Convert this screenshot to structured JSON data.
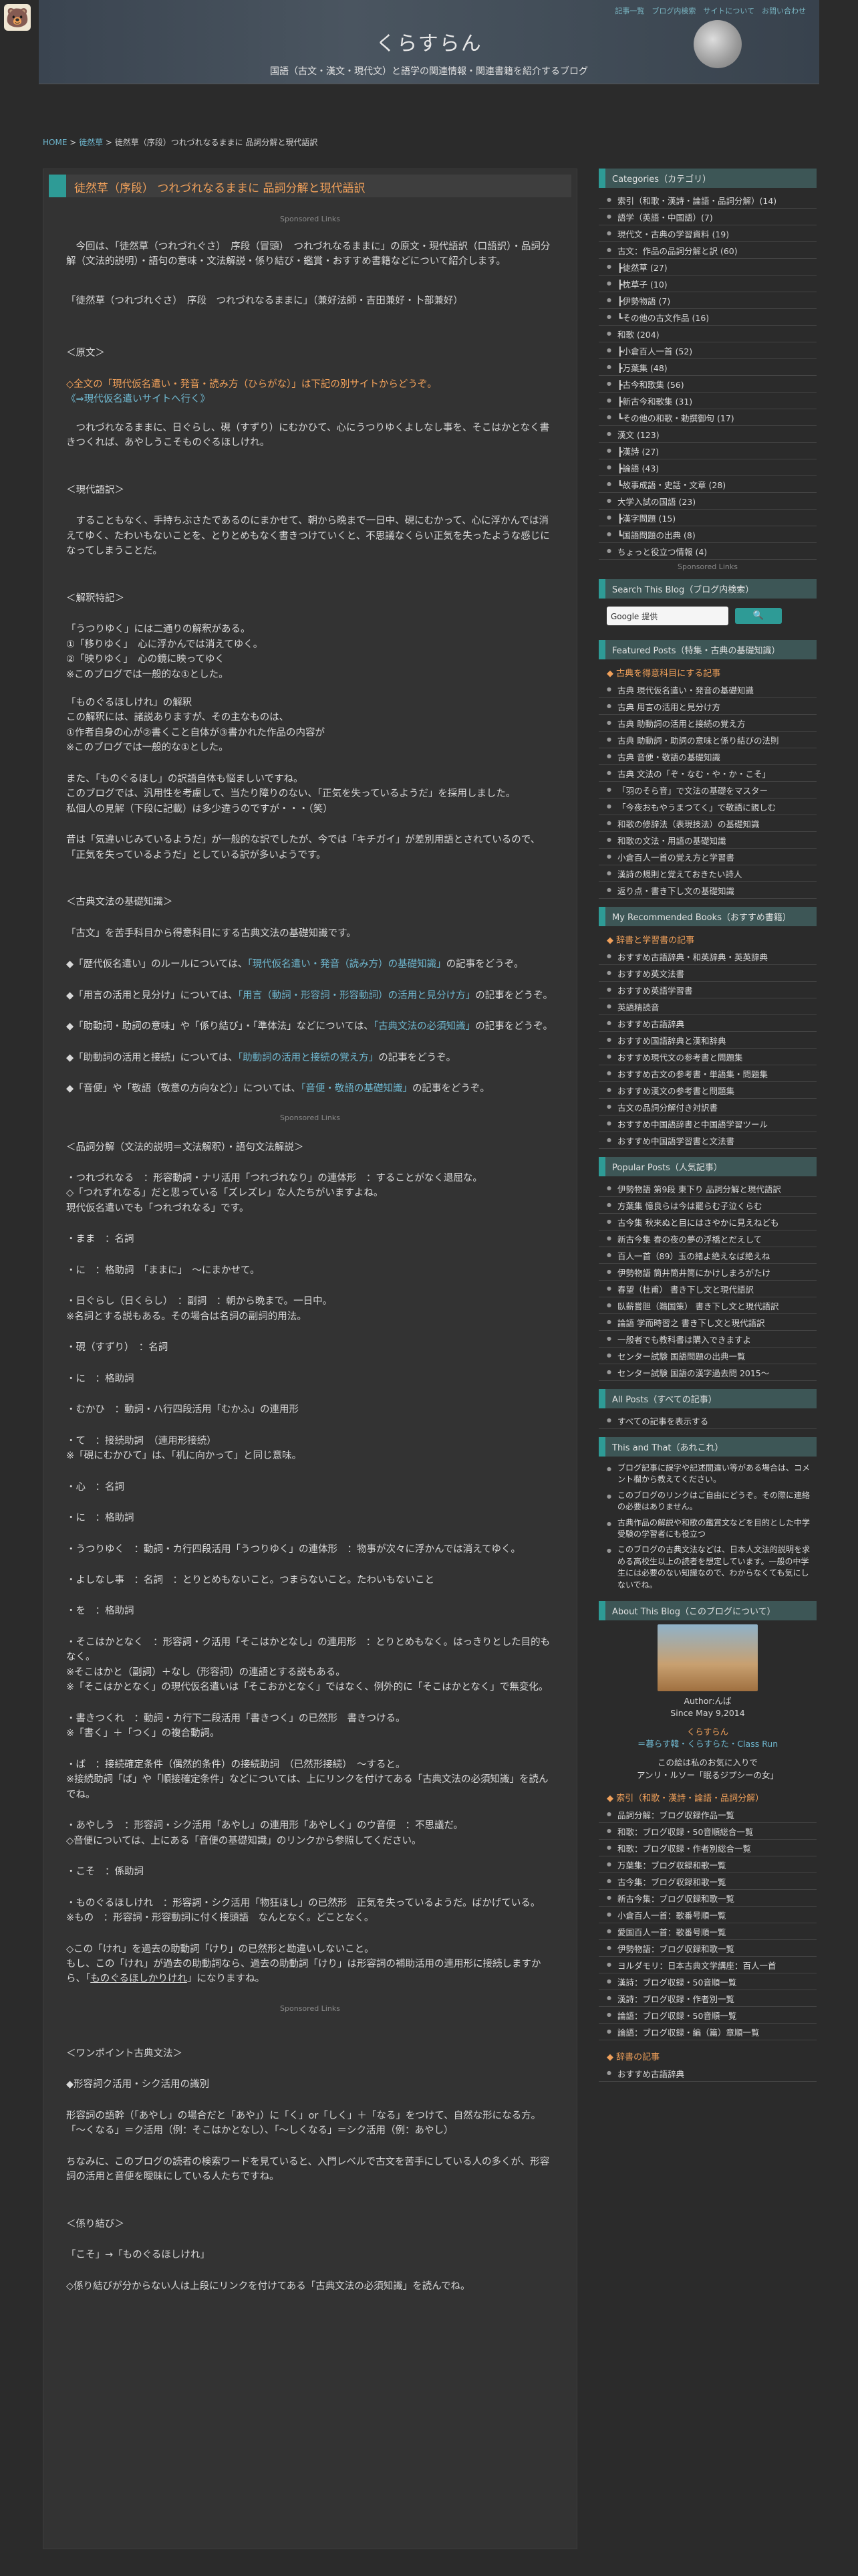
{
  "mascot": "🐻",
  "header": {
    "title": "くらすらん",
    "subtitle": "国語（古文・漢文・現代文）と語学の関連情報・関連書籍を紹介するブログ",
    "topnav": "記事一覧　ブログ内検索　サイトについて　お問い合わせ"
  },
  "breadcrumb": {
    "home": "HOME",
    "sep1": " > ",
    "cat": "徒然草",
    "rest": " > 徒然草（序段）つれづれなるままに 品詞分解と現代語訳"
  },
  "post": {
    "title": "徒然草（序段） つれづれなるままに 品詞分解と現代語訳",
    "ad": "Sponsored Links",
    "intro": "　今回は、「徒然草（つれづれぐさ）　序段（冒頭）　つれづれなるままに」の原文・現代語訳（口語訳）・品詞分解（文法的説明）・語句の意味・文法解説・係り結び・鑑賞・おすすめ書籍などについて紹介します。",
    "heading": "「徒然草（つれづれぐさ）　序段　つれづれなるままに」（兼好法師・吉田兼好・卜部兼好）",
    "gen_h": "＜原文＞",
    "gen_note": "◇全文の「現代仮名遣い・発音・読み方（ひらがな）」は下記の別サイトからどうぞ。",
    "gen_link": "《⇒現代仮名遣いサイトへ行く》",
    "gen_text": "　つれづれなるままに、日ぐらし、硯（すずり）にむかひて、心にうつりゆくよしなし事を、そこはかとなく書きつくれば、あやしうこそものぐるほしけれ。",
    "mod_h": "＜現代語訳＞",
    "mod_text": "　することもなく、手持ちぶさたであるのにまかせて、朝から晩まで一日中、硯にむかって、心に浮かんでは消えてゆく、たわいもないことを、とりとめもなく書きつけていくと、不思議なくらい正気を失ったような感じになってしまうことだ。",
    "kai_h": "＜解釈特記＞",
    "kai1": "「うつりゆく」には二通りの解釈がある。\n①「移りゆく」　心に浮かんでは消えてゆく。\n②「映りゆく」　心の鏡に映ってゆく\n※このブログでは一般的な①とした。",
    "kai2": "「ものぐるほしけれ」の解釈\nこの解釈には、諸説ありますが、その主なものは、\n①作者自身の心が②書くこと自体が③書かれた作品の内容が\n※このブログでは一般的な①とした。",
    "kai3": "また、「ものぐるほし」の訳語自体も悩ましいですね。\nこのブログでは、汎用性を考慮して、当たり障りのない、「正気を失っているようだ」を採用しました。\n私個人の見解（下段に記載）は多少違うのですが・・・（笑）",
    "kai4": "昔は「気違いじみているようだ」が一般的な訳でしたが、今では「キチガイ」が差別用語とされているので、「正気を失っているようだ」としている訳が多いようです。",
    "kiso_h": "＜古典文法の基礎知識＞",
    "kiso1": "「古文」を苦手科目から得意科目にする古典文法の基礎知識です。",
    "kiso2a": "◆「歴代仮名遣い」のルールについては、",
    "kiso2l": "「現代仮名遣い・発音（読み方）の基礎知識」",
    "kiso2b": "の記事をどうぞ。",
    "kiso3a": "◆「用言の活用と見分け」については、",
    "kiso3l": "「用言（動詞・形容詞・形容動詞）の活用と見分け方」",
    "kiso3b": "の記事をどうぞ。",
    "kiso4a": "◆「助動詞・助詞の意味」や「係り結び」・「準体法」などについては、",
    "kiso4l": "「古典文法の必須知識」",
    "kiso4b": "の記事をどうぞ。",
    "kiso5a": "◆「助動詞の活用と接続」については、",
    "kiso5l": "「助動詞の活用と接続の覚え方」",
    "kiso5b": "の記事をどうぞ。",
    "kiso6a": "◆「音便」や「敬語（敬意の方向など）」については、",
    "kiso6l": "「音便・敬語の基礎知識」",
    "kiso6b": "の記事をどうぞ。",
    "hin_h": "＜品詞分解（文法的説明＝文法解釈）・語句文法解説＞",
    "hin1": "・つれづれなる　：形容動詞・ナリ活用「つれづれなり」の連体形　：することがなく退屈な。\n◇「つれずれなる」だと思っている「ズレズレ」な人たちがいますよね。\n現代仮名遣いでも「つれづれなる」です。",
    "hin2": "・まま　：名詞",
    "hin3": "・に　：格助詞　「ままに」　～にまかせて。",
    "hin4": "・日ぐらし（日くらし）　：副詞　：朝から晩まで。一日中。\n※名詞とする説もある。その場合は名詞の副詞的用法。",
    "hin5": "・硯（すずり）　：名詞",
    "hin6": "・に　：格助詞",
    "hin7": "・むかひ　：動詞・ハ行四段活用「むかふ」の連用形",
    "hin8": "・て　：接続助詞　（連用形接続）\n※「硯にむかひて」は、「机に向かって」と同じ意味。",
    "hin9": "・心　：名詞",
    "hin10": "・に　：格助詞",
    "hin11": "・うつりゆく　：動詞・カ行四段活用「うつりゆく」の連体形　：物事が次々に浮かんでは消えてゆく。",
    "hin12": "・よしなし事　：名詞　：とりとめもないこと。つまらないこと。たわいもないこと",
    "hin13": "・を　：格助詞",
    "hin14": "・そこはかとなく　：形容詞・ク活用「そこはかとなし」の連用形　：とりとめもなく。はっきりとした目的もなく。\n※そこはかと（副詞）＋なし（形容詞）の連語とする説もある。\n※「そこはかとなく」の現代仮名遣いは「そこおかとなく」ではなく、例外的に「そこはかとなく」で無変化。",
    "hin15": "・書きつくれ　：動詞・カ行下二段活用「書きつく」の已然形　書きつける。\n※「書く」＋「つく」の複合動詞。",
    "hin16": "・ば　：接続確定条件（偶然的条件）の接続助詞　（已然形接続）　～すると。\n※接続助詞「ば」や「順接確定条件」などについては、上にリンクを付けてある「古典文法の必須知識」を読んでね。",
    "hin17": "・あやしう　：形容詞・シク活用「あやし」の連用形「あやしく」のウ音便　：不思議だ。\n◇音便については、上にある「音便の基礎知識」のリンクから参照してください。",
    "hin18": "・こそ　：係助詞",
    "hin19": "・ものぐるほしけれ　：形容詞・シク活用「物狂ほし」の已然形　正気を失っているようだ。ばかげている。\n※もの　：形容詞・形容動詞に付く接頭語　なんとなく。どことなく。",
    "hin20a": "◇この「けれ」を過去の助動詞「けり」の已然形と勘違いしないこと。\nもし、この「けれ」が過去の助動詞なら、過去の助動詞「けり」は形容詞の補助活用の連用形に接続しますから、「",
    "hin20u": "ものぐるほしかりけれ",
    "hin20b": "」になりますね。",
    "ad2": "Sponsored Links",
    "one_h": "＜ワンポイント古典文法＞",
    "one1": "◆形容詞ク活用・シク活用の識別",
    "one2": "形容詞の語幹（「あやし」の場合だと「あや」）に「く」or「しく」＋「なる」をつけて、自然な形になる方。\n「～くなる」＝ク活用（例：そこはかとなし）、「～しくなる」＝シク活用（例：あやし）",
    "one3": "ちなみに、このブログの読者の検索ワードを見ていると、入門レベルで古文を苦手にしている人の多くが、形容詞の活用と音便を曖昧にしている人たちですね。",
    "kakari_h": "＜係り結び＞",
    "kakari1": "「こそ」→「ものぐるほしけれ」",
    "kakari2": "◇係り結びが分からない人は上段にリンクを付けてある「古典文法の必須知識」を読んでね。"
  },
  "sidebar": {
    "cat_title": "Categories（カテゴリ）",
    "cats": [
      "索引（和歌・漢詩・論語・品詞分解）(14)",
      "語学（英語・中国語）(7)",
      "現代文・古典の学習資料 (19)",
      "古文：作品の品詞分解と訳 (60)",
      "┣徒然草 (27)",
      "┣枕草子 (10)",
      "┣伊勢物語 (7)",
      "┗その他の古文作品 (16)",
      "和歌 (204)",
      "┣小倉百人一首 (52)",
      "┣万葉集 (48)",
      "┣古今和歌集 (56)",
      "┣新古今和歌集 (31)",
      "┗その他の和歌・勅撰御句 (17)",
      "漢文 (123)",
      "┣漢詩 (27)",
      "┣論語 (43)",
      "┗故事成語・史話・文章 (28)",
      "大学入試の国語 (23)",
      "┣漢字問題 (15)",
      "┗国語問題の出典 (8)",
      "ちょっと役立つ情報 (4)"
    ],
    "sp": "Sponsored Links",
    "search_title": "Search This Blog（ブログ内検索）",
    "search_ph": "Google 提供",
    "search_btn": "🔍",
    "feat_title": "Featured Posts（特集・古典の基礎知識）",
    "feat_sub": "◆ 古典を得意科目にする記事",
    "feat": [
      "古典 現代仮名遣い・発音の基礎知識",
      "古典 用言の活用と見分け方",
      "古典 助動詞の活用と接続の覚え方",
      "古典 助動詞・助詞の意味と係り結びの法則",
      "古典 音便・敬語の基礎知識",
      "古典 文法の「ぞ・なむ・や・か・こそ」",
      "「羽のそら音」で文法の基礎をマスター",
      "「今夜おもやうまつてく」で敬語に親しむ",
      "和歌の修辞法（表現技法）の基礎知識",
      "和歌の文法・用語の基礎知識",
      "小倉百人一首の覚え方と学習書",
      "漢詩の規則と覚えておきたい詩人",
      "返り点・書き下し文の基礎知識"
    ],
    "rec_title": "My Recommended Books（おすすめ書籍）",
    "rec_sub": "◆ 辞書と学習書の記事",
    "rec": [
      "おすすめ古語辞典・和英辞典・英英辞典",
      "おすすめ英文法書",
      "おすすめ英語学習書",
      "英語精読音",
      "おすすめ古語辞典",
      "おすすめ国語辞典と漢和辞典",
      "おすすめ現代文の参考書と問題集",
      "おすすめ古文の参考書・単語集・問題集",
      "おすすめ漢文の参考書と問題集",
      "古文の品詞分解付き対訳書",
      "おすすめ中国語辞書と中国語学習ツール",
      "おすすめ中国語学習書と文法書"
    ],
    "pop_title": "Popular Posts（人気記事）",
    "pop": [
      "伊勢物語 第9段 東下り 品詞分解と現代語訳",
      "方葉集 憶良らは今は罷らむ子泣くらむ",
      "古今集 秋来ぬと目にはさやかに見えねども",
      "新古今集 春の夜の夢の浮橋とだえして",
      "百人一首（89）玉の緒よ絶えなば絶えね",
      "伊勢物語 筒井筒井筒にかけしまろがたけ",
      "春望（杜甫） 書き下し文と現代語訳",
      "臥薪嘗胆（鵜国策） 書き下し文と現代語訳",
      "論語 学而時習之 書き下し文と現代語訳",
      "一般者でも教科書は購入できますよ",
      "センター試験 国語問題の出典一覧",
      "センター試験 国語の漢字過去問 2015〜"
    ],
    "all_title": "All Posts（すべての記事）",
    "all": [
      "すべての記事を表示する"
    ],
    "tat_title": "This and That（あれこれ）",
    "tat1": "ブログ記事に誤字や記述間違い等がある場合は、コメント欄から教えてください。",
    "tat2": "このブログのリンクはご自由にどうぞ。その際に連絡の必要はありません。",
    "tat3": "古典作品の解説や和歌の鑑賞文などを目的とした中学受験の学習者にも役立つ",
    "tat4": "このブログの古典文法などは、日本人文法的説明を求める高校生以上の読者を想定しています。一般の中学生には必要のない知識なので、わからなくても気にしないでね。",
    "about_title": "About This Blog（このブログについて）",
    "author": "Author:んば",
    "since": "Since May 9,2014",
    "blogname": "くらすらん",
    "blogsub": "＝暮らす韓・くらすらた・Class Run",
    "blogdesc": "この絵は私のお気に入りで\nアンリ・ルソー「眠るジプシーの女」",
    "idx_sub": "◆ 索引（和歌・漢詩・論語・品詞分解）",
    "idx": [
      "品詞分解：ブログ収録作品一覧",
      "和歌：ブログ収録・50音順総合一覧",
      "和歌：ブログ収録・作者別総合一覧",
      "万葉集：ブログ収録和歌一覧",
      "古今集：ブログ収録和歌一覧",
      "新古今集：ブログ収録和歌一覧",
      "小倉百人一首：歌番号順一覧",
      "愛国百人一首：歌番号順一覧",
      "伊勢物語：ブログ収録和歌一覧",
      "ヨルダモリ：日本古典文学講座：百人一首",
      "漢詩：ブログ収録・50音順一覧",
      "漢詩：ブログ収録・作者別一覧",
      "論語：ブログ収録・50音順一覧",
      "論語：ブログ収録・編（篇）章順一覧"
    ],
    "dict_sub": "◆ 辞書の記事",
    "dict": [
      "おすすめ古語辞典"
    ]
  }
}
